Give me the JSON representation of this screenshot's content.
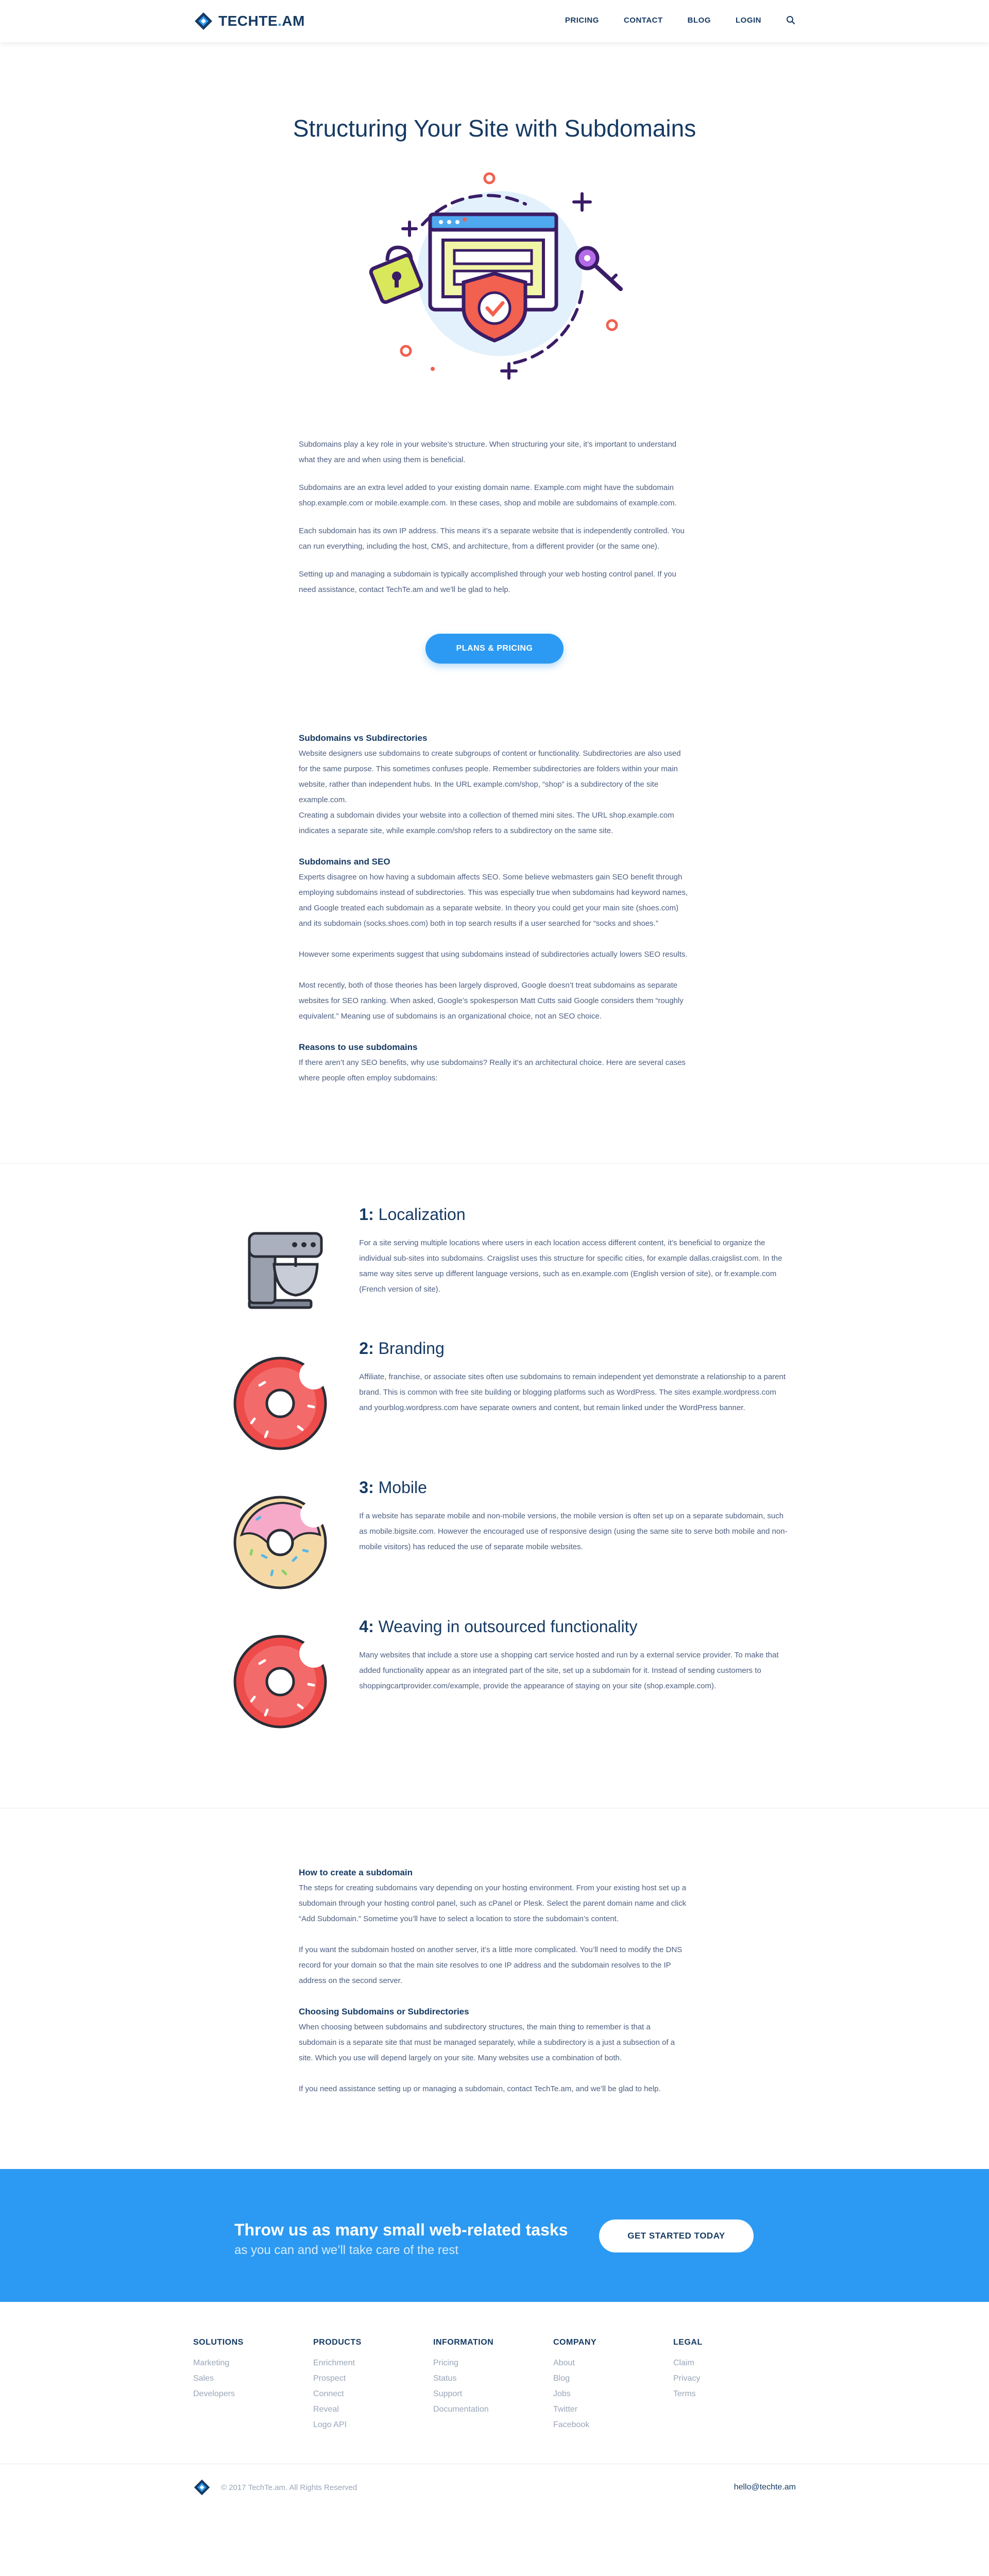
{
  "brand": {
    "name_dark": "TECHTE",
    "name_accent": ".",
    "name_tail": "AM"
  },
  "colors": {
    "accent": "#2c9af2",
    "navy": "#163a63",
    "text": "#4d5e80",
    "muted": "#9aa6b8"
  },
  "nav": [
    {
      "label": "PRICING"
    },
    {
      "label": "CONTACT"
    },
    {
      "label": "BLOG"
    },
    {
      "label": "LOGIN"
    }
  ],
  "nav_search_icon": "search-icon",
  "hero": {
    "title": "Structuring Your Site with Subdomains"
  },
  "intro": [
    "Subdomains play a key role in your website’s structure. When structuring your site, it’s important to understand what they are and when using them is beneficial.",
    "Subdomains are an extra level added to your existing domain name. Example.com might have the subdomain shop.example.com or mobile.example.com. In these cases, shop and mobile are subdomains of example.com.",
    "Each subdomain has its own IP address. This means it’s a separate website that is independently controlled. You can run everything, including the host, CMS, and architecture, from a different provider (or the same one).",
    "Setting up and managing a subdomain is typically accomplished through your web hosting control panel. If you need assistance, contact TechTe.am and we’ll be glad to help."
  ],
  "cta": {
    "label": "PLANS & PRICING"
  },
  "section2": {
    "h1": "Subdomains vs Subdirectories",
    "p1": "Website designers use subdomains to create subgroups of content or functionality. Subdirectories are also used for the same purpose. This sometimes confuses people. Remember subdirectories are folders within your main website, rather than independent hubs. In the URL example.com/shop, “shop” is a subdirectory of the site example.com.",
    "p2": "Creating a subdomain divides your website into a collection of themed mini sites. The URL shop.example.com indicates a separate site, while example.com/shop refers to a subdirectory on the same site.",
    "h2": "Subdomains and SEO",
    "p3": "Experts disagree on how having a subdomain affects SEO. Some believe webmasters gain SEO benefit through employing subdomains instead of subdirectories. This was especially true when subdomains had keyword names, and Google treated each subdomain as a separate website. In theory you could get your main site (shoes.com) and its subdomain (socks.shoes.com) both in top search results if a user searched for “socks and shoes.”",
    "p4": "However some experiments suggest that using subdomains instead of subdirectories actually lowers SEO results.",
    "p5": "Most recently, both of those theories has been largely disproved, Google doesn’t treat subdomains as separate websites for SEO ranking. When asked, Google’s spokesperson Matt Cutts said Google considers them “roughly equivalent.” Meaning use of subdomains is an organizational choice, not an SEO choice.",
    "h3": "Reasons to use subdomains",
    "p6": "If there aren’t any SEO benefits, why use subdomains? Really it’s an architectural choice. Here are several cases where people often employ subdomains:"
  },
  "reasons": [
    {
      "num": "1:",
      "title": "Localization",
      "icon": "stand-mixer-icon",
      "text": "For a site serving multiple locations where users in each location access different content, it’s beneficial to organize the individual sub-sites into subdomains. Craigslist uses this structure for specific cities, for example dallas.craigslist.com. In the same way sites serve up different language versions, such as en.example.com (English version of site), or fr.example.com (French version of site)."
    },
    {
      "num": "2:",
      "title": "Branding",
      "icon": "donut-icon",
      "text": "Affiliate, franchise, or associate sites often use subdomains to remain independent yet demonstrate a relationship to a parent brand. This is common with free site building or blogging platforms such as WordPress. The sites example.wordpress.com and yourblog.wordpress.com have separate owners and content, but remain linked under the WordPress banner."
    },
    {
      "num": "3:",
      "title": "Mobile",
      "icon": "sprinkle-donut-icon",
      "text": "If a website has separate mobile and non-mobile versions, the mobile version is often set up on a separate subdomain, such as mobile.bigsite.com. However the encouraged use of responsive design (using the same site to serve both mobile and non-mobile visitors) has reduced the use of separate mobile websites."
    },
    {
      "num": "4:",
      "title": "Weaving in outsourced functionality",
      "icon": "donut-icon",
      "text": "Many websites that include a store use a shopping cart service hosted and run by a external service provider. To make that added functionality appear as an integrated part of the site, set up a subdomain for it. Instead of sending customers to shoppingcartprovider.com/example, provide the appearance of staying on your site (shop.example.com)."
    }
  ],
  "how": {
    "h1": "How to create a subdomain",
    "p1": "The steps for creating subdomains vary depending on your hosting environment. From your existing host set up a subdomain through your hosting control panel, such as cPanel or Plesk. Select the parent domain name and click “Add Subdomain.” Sometime you’ll have to select a location to store the subdomain’s content.",
    "p2": "If you want the subdomain hosted on another server, it’s a little more complicated. You’ll need to modify the DNS record for your domain so that the main site resolves to one IP address and the subdomain resolves to the IP address on the second server.",
    "h2": "Choosing Subdomains or Subdirectories",
    "p3": "When choosing between subdomains and subdirectory structures, the main thing to remember is that a subdomain is a separate site that must be managed separately, while a subdirectory is a just a subsection of a site. Which you use will depend largely on your site. Many websites use a combination of both.",
    "p4": "If you need assistance setting up or managing a subdomain, contact TechTe.am, and we’ll be glad to help."
  },
  "banner": {
    "title": "Throw us as many small web-related tasks",
    "subtitle": "as you can and we’ll take care of the rest",
    "button": "GET STARTED TODAY"
  },
  "footer": [
    {
      "heading": "SOLUTIONS",
      "links": [
        "Marketing",
        "Sales",
        "Developers"
      ]
    },
    {
      "heading": "PRODUCTS",
      "links": [
        "Enrichment",
        "Prospect",
        "Connect",
        "Reveal",
        "Logo API"
      ]
    },
    {
      "heading": "INFORMATION",
      "links": [
        "Pricing",
        "Status",
        "Support",
        "Documentation"
      ]
    },
    {
      "heading": "COMPANY",
      "links": [
        "About",
        "Blog",
        "Jobs",
        "Twitter",
        "Facebook"
      ]
    },
    {
      "heading": "LEGAL",
      "links": [
        "Claim",
        "Privacy",
        "Terms"
      ]
    }
  ],
  "bottom": {
    "copyright": "© 2017 TechTe.am. All Rights Reserved",
    "email": "hello@techte.am"
  }
}
